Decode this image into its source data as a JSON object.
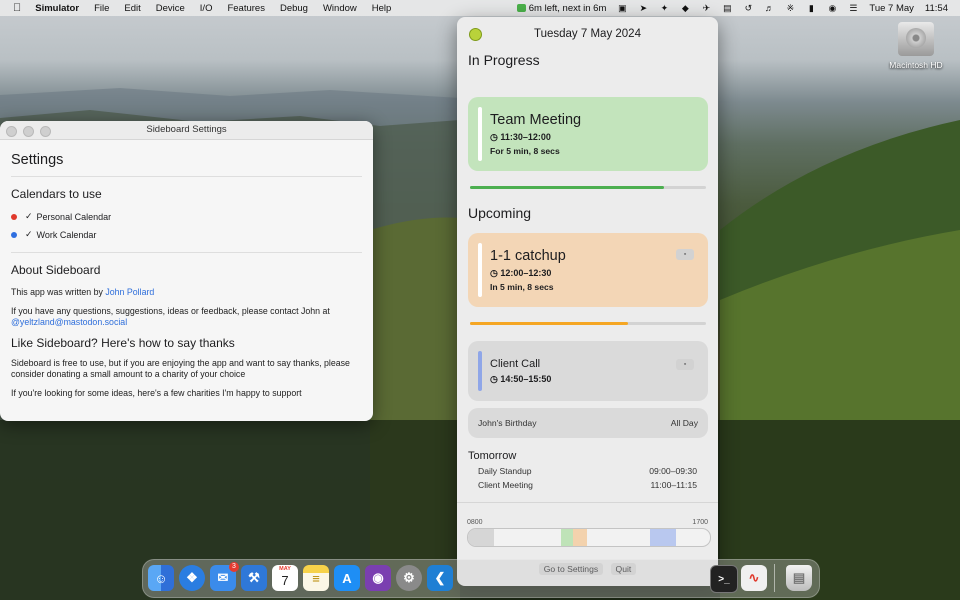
{
  "menubar": {
    "apple_icon": "apple-logo-icon",
    "app_name": "Simulator",
    "menus": [
      "File",
      "Edit",
      "Device",
      "I/O",
      "Features",
      "Debug",
      "Window",
      "Help"
    ],
    "status_event": "6m left, next in 6m",
    "date": "Tue 7 May",
    "time": "11:54"
  },
  "desktop": {
    "drive_label": "Macintosh HD"
  },
  "settings_window": {
    "title": "Sideboard Settings",
    "heading": "Settings",
    "calendars_heading": "Calendars to use",
    "calendars": [
      {
        "name": "Personal Calendar",
        "color": "#e0392b"
      },
      {
        "name": "Work Calendar",
        "color": "#2f6fe0"
      }
    ],
    "about_heading": "About Sideboard",
    "about_text": "This app was written by",
    "author_link": "John Pollard",
    "contact_text": "If you have any questions, suggestions, ideas or feedback, please contact John at",
    "contact_link": "@yeltzland@mastodon.social",
    "thanks_heading": "Like Sideboard? Here's how to say thanks",
    "thanks_text": "Sideboard is free to use, but if you are enjoying the app and want to say thanks, please consider donating a small amount to a charity of your choice",
    "charities_text": "If you're looking for some ideas, here's a few charities I'm happy to support"
  },
  "panel": {
    "date": "Tuesday 7 May 2024",
    "in_progress_heading": "In Progress",
    "in_progress": {
      "title": "Team Meeting",
      "time": "11:30–12:00",
      "relative": "For 5 min, 8 secs",
      "color": "#c3e4bc",
      "progress": 0.82,
      "progress_color": "#4caf50"
    },
    "upcoming_heading": "Upcoming",
    "upcoming": [
      {
        "title": "1-1 catchup",
        "time": "12:00–12:30",
        "relative": "In 5 min, 8 secs",
        "color": "#f3d6b6",
        "progress": 0.67,
        "progress_color": "#f5a623"
      },
      {
        "title": "Client Call",
        "time": "14:50–15:50",
        "color": "#dadada",
        "bar_color": "#8fa6e8"
      }
    ],
    "all_day": {
      "title": "John's Birthday",
      "label": "All Day"
    },
    "tomorrow_heading": "Tomorrow",
    "tomorrow": [
      {
        "title": "Daily Standup",
        "time": "09:00–09:30"
      },
      {
        "title": "Client Meeting",
        "time": "11:00–11:15"
      }
    ],
    "timeline": {
      "start": "0800",
      "end": "1700"
    },
    "buttons": {
      "settings": "Go to Settings",
      "quit": "Quit"
    }
  },
  "dock": {
    "apps": [
      {
        "name": "Finder",
        "color": "#3d8ef0"
      },
      {
        "name": "Safari",
        "color": "#2a7de1"
      },
      {
        "name": "Mail",
        "color": "#3b8bea",
        "badge": "3"
      },
      {
        "name": "Xcode",
        "color": "#2f78d8"
      },
      {
        "name": "Calendar",
        "color": "#ffffff",
        "month": "MAY",
        "day": "7"
      },
      {
        "name": "Notes",
        "color": "#f6d24a"
      },
      {
        "name": "App Store",
        "color": "#1e8ef5"
      },
      {
        "name": "GitHub Desktop",
        "color": "#7a3fb0"
      },
      {
        "name": "System Settings",
        "color": "#8a8a8a"
      },
      {
        "name": "Visual Studio Code",
        "color": "#1f7fd4"
      },
      {
        "name": "Terminal",
        "color": "#222222"
      },
      {
        "name": "Freeform",
        "color": "#f0f0f0"
      },
      {
        "name": "Trash",
        "color": "#cfcfcf"
      }
    ]
  }
}
